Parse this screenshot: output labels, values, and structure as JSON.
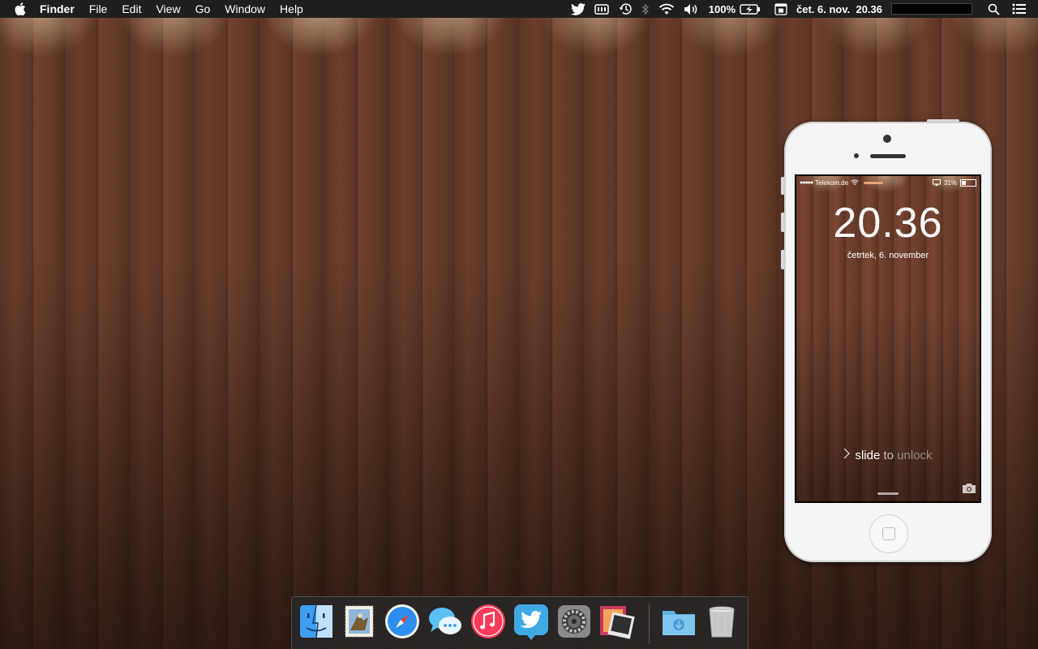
{
  "menubar": {
    "app_name": "Finder",
    "menus": [
      "File",
      "Edit",
      "View",
      "Go",
      "Window",
      "Help"
    ],
    "battery_percent": "100%",
    "clock": "čet. 6. nov.  20.36",
    "icons": [
      "apple-icon",
      "twitter-icon",
      "memory-icon",
      "time-machine-icon",
      "bluetooth-icon",
      "wifi-icon",
      "volume-icon",
      "battery-icon",
      "calendar-icon",
      "spotlight-icon",
      "notification-center-icon"
    ]
  },
  "phone": {
    "carrier": "Telekom.de",
    "battery": "31%",
    "time": "20.36",
    "date": "četrtek, 6. november",
    "slide_prefix": "slide ",
    "slide_mid": "to ",
    "slide_suffix": "unlock"
  },
  "dock": {
    "items": [
      "Finder",
      "Mail",
      "Safari",
      "Messages",
      "iTunes",
      "Twitter",
      "System Preferences",
      "Photo Booth"
    ],
    "right_items": [
      "Downloads",
      "Trash"
    ]
  },
  "colors": {
    "menubar_bg": "#1f1f1f",
    "wood": "#5a3425",
    "twitter_blue": "#3fa9e4"
  }
}
